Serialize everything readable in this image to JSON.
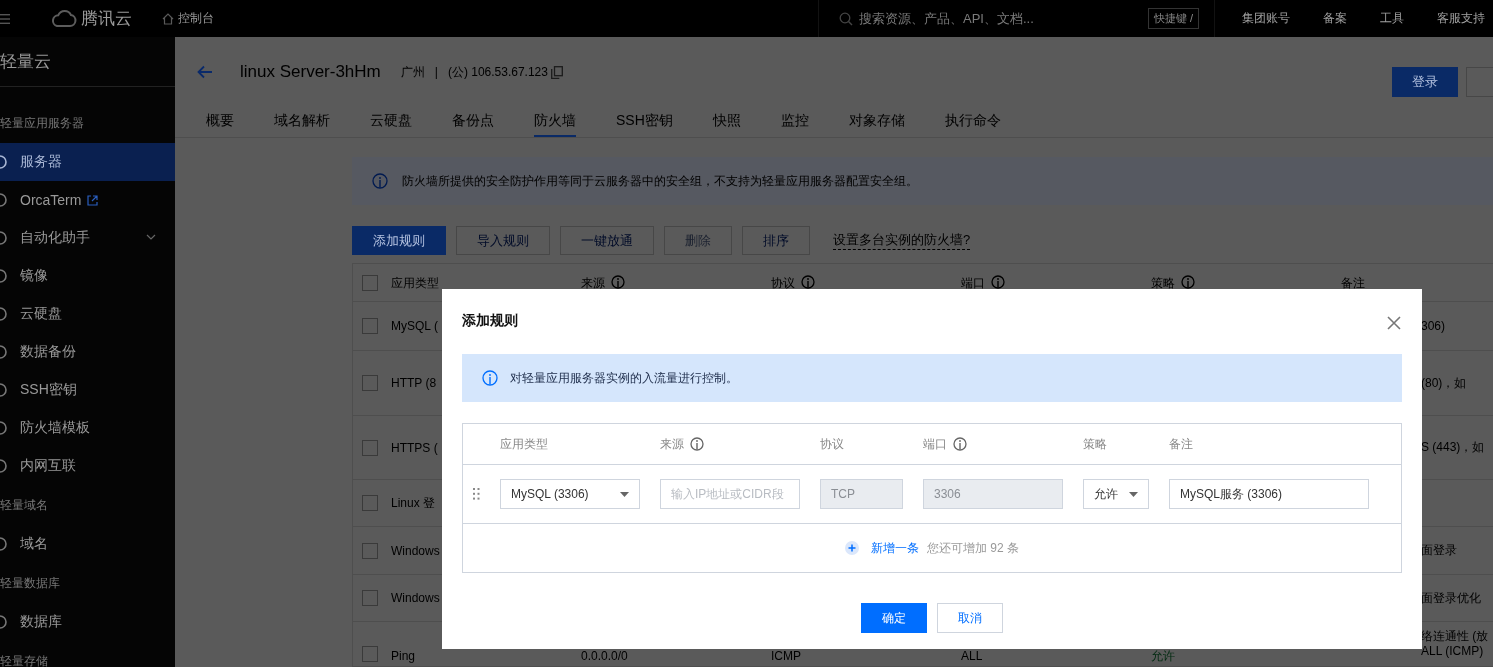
{
  "topbar": {
    "brand": "腾讯云",
    "console": "控制台",
    "search_placeholder": "搜索资源、产品、API、文档...",
    "shortcut": "快捷键 /",
    "links": [
      "集团账号",
      "备案",
      "工具",
      "客服支持"
    ]
  },
  "sidebar": {
    "title": "轻量云",
    "groups": [
      {
        "label": "轻量应用服务器",
        "items": [
          {
            "label": "服务器",
            "kind": "plain",
            "selected": true
          },
          {
            "label": "OrcaTerm",
            "kind": "external",
            "selected": false
          },
          {
            "label": "自动化助手",
            "kind": "expandable",
            "selected": false
          },
          {
            "label": "镜像",
            "kind": "plain",
            "selected": false
          },
          {
            "label": "云硬盘",
            "kind": "plain",
            "selected": false
          },
          {
            "label": "数据备份",
            "kind": "plain",
            "selected": false
          },
          {
            "label": "SSH密钥",
            "kind": "plain",
            "selected": false
          },
          {
            "label": "防火墙模板",
            "kind": "plain",
            "selected": false
          },
          {
            "label": "内网互联",
            "kind": "plain",
            "selected": false
          }
        ]
      },
      {
        "label": "轻量域名",
        "items": [
          {
            "label": "域名",
            "kind": "plain",
            "selected": false
          }
        ]
      },
      {
        "label": "轻量数据库",
        "items": [
          {
            "label": "数据库",
            "kind": "plain",
            "selected": false
          }
        ]
      },
      {
        "label": "轻量存储"
      }
    ]
  },
  "header": {
    "title": "linux Server-3hHm",
    "region": "广州",
    "separator": "|",
    "ip": "(公) 106.53.67.123",
    "buttons": [
      {
        "label": "登录",
        "kind": "primary"
      },
      {
        "kind": "default"
      }
    ]
  },
  "tabs": [
    {
      "label": "概要",
      "selected": false
    },
    {
      "label": "域名解析",
      "selected": false
    },
    {
      "label": "云硬盘",
      "selected": false
    },
    {
      "label": "备份点",
      "selected": false
    },
    {
      "label": "防火墙",
      "selected": true
    },
    {
      "label": "SSH密钥",
      "selected": false
    },
    {
      "label": "快照",
      "selected": false
    },
    {
      "label": "监控",
      "selected": false
    },
    {
      "label": "对象存储",
      "selected": false
    },
    {
      "label": "执行命令",
      "selected": false
    }
  ],
  "notice": "防火墙所提供的安全防护作用等同于云服务器中的安全组，不支持为轻量应用服务器配置安全组。",
  "toolbar": {
    "buttons": [
      {
        "label": "添加规则",
        "kind": "primary",
        "disabled": false
      },
      {
        "label": "导入规则",
        "kind": "default",
        "disabled": false
      },
      {
        "label": "一键放通",
        "kind": "default",
        "disabled": false
      },
      {
        "label": "删除",
        "kind": "default",
        "disabled": true
      },
      {
        "label": "排序",
        "kind": "default",
        "disabled": false
      }
    ],
    "link": "设置多台实例的防火墙?"
  },
  "table": {
    "all_checked": false,
    "columns": [
      {
        "label": "应用类型",
        "info": false
      },
      {
        "label": "来源",
        "info": true
      },
      {
        "label": "协议",
        "info": true
      },
      {
        "label": "端口",
        "info": true
      },
      {
        "label": "策略",
        "info": true
      },
      {
        "label": "备注",
        "info": false
      }
    ],
    "rows": [
      {
        "checked": false,
        "app_type": "MySQL (",
        "remark": [
          "306)"
        ]
      },
      {
        "checked": false,
        "app_type": "HTTP (8",
        "remark": [
          "(80)，如"
        ]
      },
      {
        "checked": false,
        "app_type": "HTTPS (",
        "remark": [
          "S (443)，如"
        ]
      },
      {
        "checked": false,
        "app_type": "Linux 登"
      },
      {
        "checked": false,
        "app_type": "Windows",
        "remark": [
          "面登录"
        ]
      },
      {
        "checked": false,
        "app_type": "Windows",
        "remark": [
          "面登录优化"
        ]
      },
      {
        "checked": false,
        "app_type": "Ping",
        "source": "0.0.0.0/0",
        "protocol": "ICMP",
        "port": "ALL",
        "policy": "允许",
        "remark": [
          "络连通性 (放",
          "ALL (ICMP)"
        ]
      }
    ]
  },
  "modal": {
    "title": "添加规则",
    "notice": "对轻量应用服务器实例的入流量进行控制。",
    "columns": [
      {
        "label": "应用类型",
        "info": false
      },
      {
        "label": "来源",
        "info": true
      },
      {
        "label": "协议",
        "info": false
      },
      {
        "label": "端口",
        "info": true
      },
      {
        "label": "策略",
        "info": false
      },
      {
        "label": "备注",
        "info": false
      }
    ],
    "rules": [
      {
        "cells": [
          {
            "kind": "select",
            "value": "MySQL (3306)",
            "disabled": false
          },
          {
            "kind": "input",
            "placeholder": "输入IP地址或CIDR段",
            "disabled": false
          },
          {
            "kind": "input",
            "value": "TCP",
            "disabled": true
          },
          {
            "kind": "input",
            "value": "3306",
            "disabled": true
          },
          {
            "kind": "select",
            "value": "允许",
            "disabled": false
          },
          {
            "kind": "input",
            "value": "MySQL服务 (3306)",
            "disabled": false
          }
        ]
      }
    ],
    "add_link": "新增一条",
    "quota": "您还可增加 92 条",
    "buttons": [
      {
        "label": "确定",
        "kind": "primary"
      },
      {
        "label": "取消",
        "kind": "default"
      }
    ]
  }
}
